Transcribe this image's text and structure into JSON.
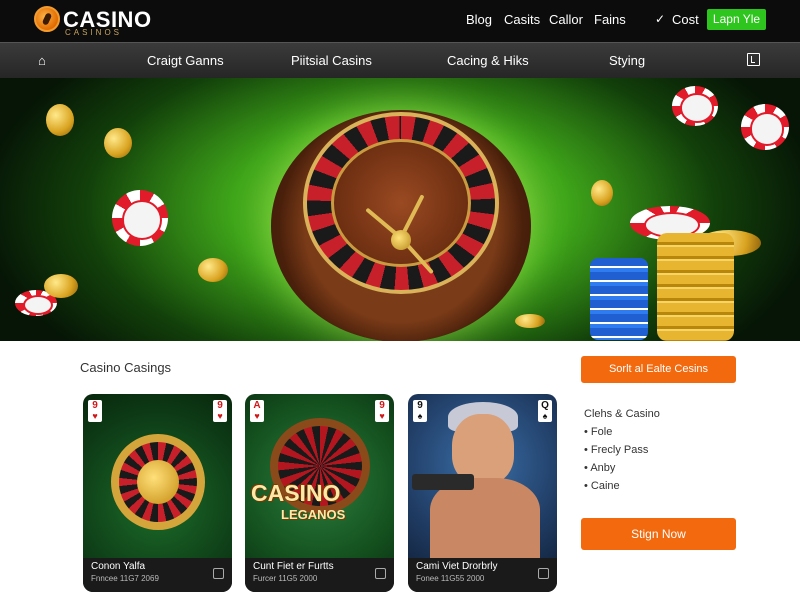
{
  "header": {
    "logo_text": "CASINO",
    "logo_sub": "CASINOS",
    "links": [
      "Blog",
      "Casits",
      "Callor",
      "Fains"
    ],
    "cost_label": "Cost",
    "login_label": "Lapn Yle",
    "brand_color": "#f2690e",
    "login_color": "#2fc51f"
  },
  "nav": {
    "home_icon": "home-icon",
    "items": [
      "Craigt Ganns",
      "Piitsial Casins",
      "Cacing & Hiks",
      "Stying"
    ],
    "menu_icon": "menu-icon"
  },
  "hero": {
    "scene": "roulette-wheel-chips-coins"
  },
  "content": {
    "section_title": "Casino Casings",
    "cards": [
      {
        "title": "Conon Yalfa",
        "sub": "Fnncee 11G7 2069",
        "corner_left": "9",
        "corner_right": "9",
        "left_suit": "heart",
        "right_suit": "heart"
      },
      {
        "title": "Cunt Fiet er Furtts",
        "sub": "Furcer 11G5 2000",
        "corner_left": "A",
        "corner_right": "9",
        "left_suit": "heart",
        "right_suit": "heart",
        "art_text": "CASINO",
        "art_text2": "LEGANOS"
      },
      {
        "title": "Cami Viet Drorbrly",
        "sub": "Fonee 11G55 2000",
        "corner_left": "9",
        "corner_right": "Q",
        "left_suit": "spade",
        "right_suit": "spade"
      }
    ]
  },
  "sidebar": {
    "top_button": "Sorlt al Ealte Cesins",
    "heading": "Clehs & Casino",
    "items": [
      "Fole",
      "Frecly Pass",
      "Anby",
      "Caine"
    ],
    "bottom_button": "Stign Now"
  }
}
